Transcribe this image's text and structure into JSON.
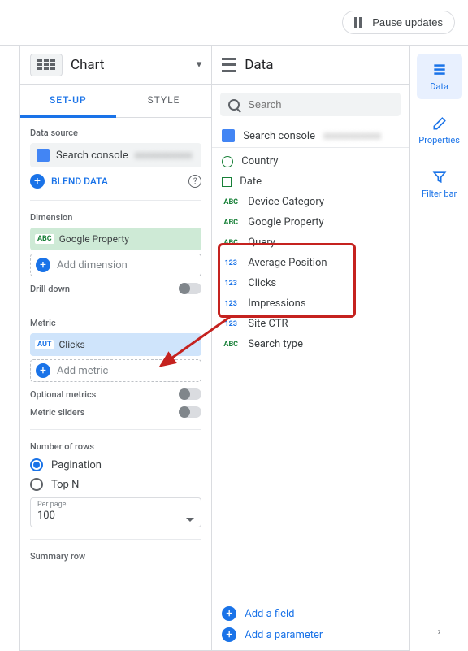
{
  "topbar": {
    "pause": "Pause updates"
  },
  "chart": {
    "title": "Chart",
    "tab_setup": "SET-UP",
    "tab_style": "STYLE",
    "data_source_label": "Data source",
    "data_source_value": "Search console",
    "blend": "BLEND DATA",
    "dimension_label": "Dimension",
    "dimension_value": "Google Property",
    "add_dimension": "Add dimension",
    "drilldown": "Drill down",
    "metric_label": "Metric",
    "metric_value": "Clicks",
    "metric_badge": "AUT",
    "add_metric": "Add metric",
    "optional_metrics": "Optional metrics",
    "metric_sliders": "Metric sliders",
    "rows_label": "Number of rows",
    "pagination": "Pagination",
    "topn": "Top N",
    "perpage_label": "Per page",
    "perpage_value": "100",
    "summary_row": "Summary row"
  },
  "data": {
    "title": "Data",
    "search_placeholder": "Search",
    "source": "Search console",
    "fields": [
      {
        "type": "geo",
        "label": "Country"
      },
      {
        "type": "date",
        "label": "Date"
      },
      {
        "type": "abc",
        "label": "Device Category"
      },
      {
        "type": "abc",
        "label": "Google Property"
      },
      {
        "type": "abc",
        "label": "Query"
      },
      {
        "type": "num",
        "label": "Average Position"
      },
      {
        "type": "num",
        "label": "Clicks"
      },
      {
        "type": "num",
        "label": "Impressions"
      },
      {
        "type": "num",
        "label": "Site CTR"
      },
      {
        "type": "abc",
        "label": "Search type"
      }
    ],
    "add_field": "Add a field",
    "add_param": "Add a parameter"
  },
  "rail": {
    "data": "Data",
    "properties": "Properties",
    "filterbar": "Filter bar"
  }
}
